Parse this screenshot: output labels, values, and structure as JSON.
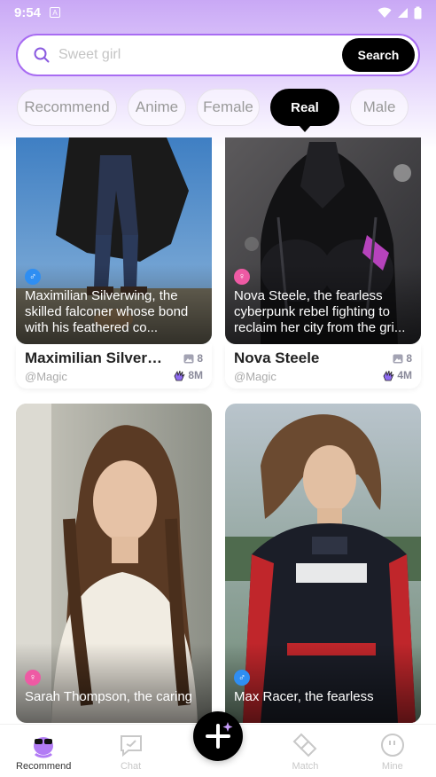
{
  "status": {
    "time": "9:54",
    "a_icon": "A"
  },
  "search": {
    "placeholder": "Sweet girl",
    "button_label": "Search"
  },
  "tabs": [
    {
      "label": "Recommend",
      "active": false
    },
    {
      "label": "Anime",
      "active": false
    },
    {
      "label": "Female",
      "active": false
    },
    {
      "label": "Real",
      "active": true
    },
    {
      "label": "Male",
      "active": false
    }
  ],
  "cards": [
    {
      "gender": "male",
      "description": "Maximilian Silverwing, the skilled falconer whose bond with his feathered co...",
      "name": "Maximilian Silverw...",
      "author": "@Magic",
      "images": "8",
      "likes": "8M"
    },
    {
      "gender": "female",
      "description": "Nova Steele, the fearless cyberpunk rebel fighting to reclaim her city from the gri...",
      "name": "Nova Steele",
      "author": "@Magic",
      "images": "8",
      "likes": "4M"
    },
    {
      "gender": "female",
      "description": "Sarah Thompson, the caring",
      "name": "",
      "author": "",
      "images": "",
      "likes": ""
    },
    {
      "gender": "male",
      "description": "Max Racer, the fearless",
      "name": "",
      "author": "",
      "images": "",
      "likes": ""
    }
  ],
  "nav": [
    {
      "label": "Recommend",
      "icon": "recommend-icon",
      "active": true
    },
    {
      "label": "Chat",
      "icon": "chat-icon",
      "active": false
    },
    {
      "label": "Match",
      "icon": "match-icon",
      "active": false
    },
    {
      "label": "Mine",
      "icon": "mine-icon",
      "active": false
    }
  ],
  "colors": {
    "accent": "#a86cf2",
    "male": "#2f8ef2",
    "female": "#ee5aa4"
  }
}
